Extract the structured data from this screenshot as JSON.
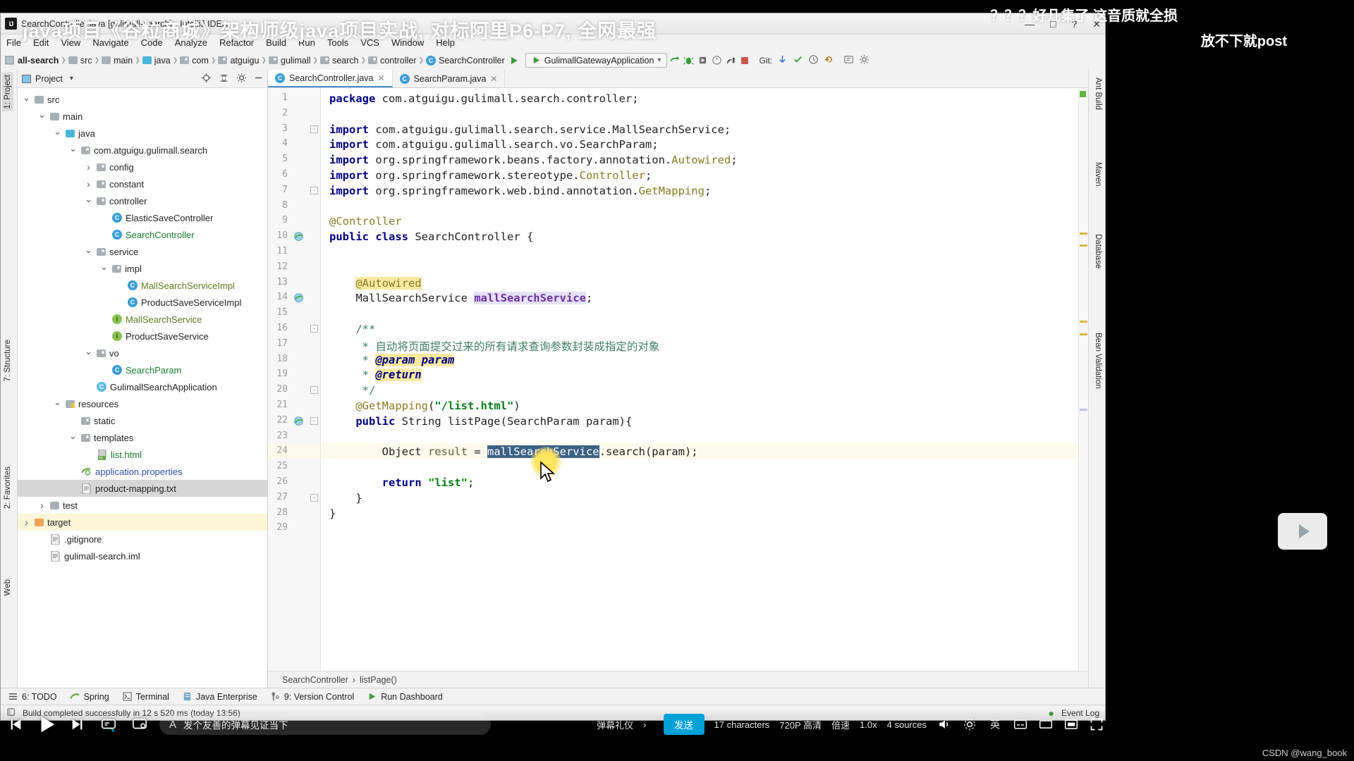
{
  "window": {
    "title": "SearchController.java [gulimall-search] - IntelliJ IDEA",
    "logo": "IJ",
    "minimize": "—",
    "maximize": "□",
    "help": "?",
    "close": "✕"
  },
  "menubar": [
    "File",
    "Edit",
    "View",
    "Navigate",
    "Code",
    "Analyze",
    "Refactor",
    "Build",
    "Run",
    "Tools",
    "VCS",
    "Window",
    "Help"
  ],
  "navbar": {
    "crumbs": [
      {
        "label": "all-search",
        "icon": "module-icon",
        "bold": true
      },
      {
        "label": "src",
        "icon": "folder-gray-icon"
      },
      {
        "label": "main",
        "icon": "folder-gray-icon"
      },
      {
        "label": "java",
        "icon": "folder-source-icon"
      },
      {
        "label": "com",
        "icon": "package-icon"
      },
      {
        "label": "atguigu",
        "icon": "package-icon"
      },
      {
        "label": "gulimall",
        "icon": "package-icon"
      },
      {
        "label": "search",
        "icon": "package-icon"
      },
      {
        "label": "controller",
        "icon": "package-icon"
      },
      {
        "label": "SearchController",
        "icon": "class-icon"
      }
    ],
    "run_config": "GulimallGatewayApplication",
    "run_config_dropdown": "▾",
    "git_label": "Git:"
  },
  "project_panel": {
    "title": "Project",
    "dropdown": "▾",
    "tree": [
      {
        "label": "src",
        "indent": 0,
        "twist": "v",
        "icon": "folder-gray-icon",
        "color": ""
      },
      {
        "label": "main",
        "indent": 1,
        "twist": "v",
        "icon": "folder-gray-icon",
        "color": ""
      },
      {
        "label": "java",
        "indent": 2,
        "twist": "v",
        "icon": "folder-source-icon",
        "color": ""
      },
      {
        "label": "com.atguigu.gulimall.search",
        "indent": 3,
        "twist": "v",
        "icon": "package-icon",
        "color": ""
      },
      {
        "label": "config",
        "indent": 4,
        "twist": ">",
        "icon": "package-icon",
        "color": ""
      },
      {
        "label": "constant",
        "indent": 4,
        "twist": ">",
        "icon": "package-icon",
        "color": ""
      },
      {
        "label": "controller",
        "indent": 4,
        "twist": "v",
        "icon": "package-icon",
        "color": ""
      },
      {
        "label": "ElasticSaveController",
        "indent": 5,
        "twist": "",
        "icon": "class-icon",
        "color": ""
      },
      {
        "label": "SearchController",
        "indent": 5,
        "twist": "",
        "icon": "class-icon",
        "color": "green"
      },
      {
        "label": "service",
        "indent": 4,
        "twist": "v",
        "icon": "package-icon",
        "color": ""
      },
      {
        "label": "impl",
        "indent": 5,
        "twist": "v",
        "icon": "package-icon",
        "color": ""
      },
      {
        "label": "MallSearchServiceImpl",
        "indent": 6,
        "twist": "",
        "icon": "class-icon",
        "color": "olive"
      },
      {
        "label": "ProductSaveServiceImpl",
        "indent": 6,
        "twist": "",
        "icon": "class-icon",
        "color": ""
      },
      {
        "label": "MallSearchService",
        "indent": 5,
        "twist": "",
        "icon": "interface-icon",
        "color": "olive"
      },
      {
        "label": "ProductSaveService",
        "indent": 5,
        "twist": "",
        "icon": "interface-icon",
        "color": ""
      },
      {
        "label": "vo",
        "indent": 4,
        "twist": "v",
        "icon": "package-icon",
        "color": ""
      },
      {
        "label": "SearchParam",
        "indent": 5,
        "twist": "",
        "icon": "class-icon",
        "color": "green"
      },
      {
        "label": "GulimallSearchApplication",
        "indent": 4,
        "twist": "",
        "icon": "spring-class-icon",
        "color": ""
      },
      {
        "label": "resources",
        "indent": 2,
        "twist": "v",
        "icon": "folder-resources-icon",
        "color": ""
      },
      {
        "label": "static",
        "indent": 3,
        "twist": "",
        "icon": "package-icon",
        "color": ""
      },
      {
        "label": "templates",
        "indent": 3,
        "twist": "v",
        "icon": "package-icon",
        "color": ""
      },
      {
        "label": "list.html",
        "indent": 4,
        "twist": "",
        "icon": "html-file-icon",
        "color": "green"
      },
      {
        "label": "application.properties",
        "indent": 3,
        "twist": "",
        "icon": "spring-properties-icon",
        "color": "blue"
      },
      {
        "label": "product-mapping.txt",
        "indent": 3,
        "twist": "",
        "icon": "text-file-icon",
        "color": "",
        "state": "selected"
      },
      {
        "label": "test",
        "indent": 1,
        "twist": ">",
        "icon": "folder-gray-icon",
        "color": ""
      },
      {
        "label": "target",
        "indent": 0,
        "twist": ">",
        "icon": "folder-orange-icon",
        "color": "",
        "state": "warn"
      },
      {
        "label": ".gitignore",
        "indent": 1,
        "twist": "",
        "icon": "text-file-icon",
        "color": ""
      },
      {
        "label": "gulimall-search.iml",
        "indent": 1,
        "twist": "",
        "icon": "text-file-icon",
        "color": ""
      }
    ]
  },
  "left_tool_tabs": [
    "1: Project",
    "7: Structure",
    "2: Favorites",
    "Web"
  ],
  "right_tool_tabs": [
    "Ant Build",
    "Maven",
    "Database",
    "Bean Validation"
  ],
  "editor": {
    "tabs": [
      {
        "label": "SearchController.java",
        "icon": "class-icon",
        "active": true,
        "close": "✕"
      },
      {
        "label": "SearchParam.java",
        "icon": "class-icon",
        "active": false,
        "close": "✕"
      }
    ],
    "breadcrumb": [
      "SearchController",
      "listPage()"
    ],
    "breadcrumb_sep": "›",
    "lines": [
      {
        "n": 1,
        "html": "<span class='kw'>package</span> com.atguigu.gulimall.search.controller;"
      },
      {
        "n": 2,
        "html": ""
      },
      {
        "n": 3,
        "html": "<span class='kw'>import</span> com.atguigu.gulimall.search.service.MallSearchService;",
        "fold": "-"
      },
      {
        "n": 4,
        "html": "<span class='kw'>import</span> com.atguigu.gulimall.search.vo.SearchParam;"
      },
      {
        "n": 5,
        "html": "<span class='kw'>import</span> org.springframework.beans.factory.annotation.<span class='ann'>Autowired</span>;"
      },
      {
        "n": 6,
        "html": "<span class='kw'>import</span> org.springframework.stereotype.<span class='ann'>Controller</span>;"
      },
      {
        "n": 7,
        "html": "<span class='kw'>import</span> org.springframework.web.bind.annotation.<span class='ann'>GetMapping</span>;",
        "fold": "-"
      },
      {
        "n": 8,
        "html": ""
      },
      {
        "n": 9,
        "html": "<span class='ann'>@Controller</span>"
      },
      {
        "n": 10,
        "html": "<span class='kw'>public</span> <span class='kw'>class</span> SearchController {",
        "gmark": "spring-bean-icon"
      },
      {
        "n": 11,
        "html": ""
      },
      {
        "n": 12,
        "html": ""
      },
      {
        "n": 13,
        "html": "    <span class='ann hly'>@Autowired</span>"
      },
      {
        "n": 14,
        "html": "    MallSearchService <span class='fld hlv'>mallSearchService</span>;",
        "gmark": "bean-injection-icon"
      },
      {
        "n": 15,
        "html": ""
      },
      {
        "n": 16,
        "html": "    <span class='cmt'>/**</span>",
        "fold": "-"
      },
      {
        "n": 17,
        "html": "     <span class='cmt'>* 自动将页面提交过来的所有请求查询参数封装成指定的对象</span>"
      },
      {
        "n": 18,
        "html": "     <span class='cmt'>* </span><span class='cmtb hly'>@param param</span>"
      },
      {
        "n": 19,
        "html": "     <span class='cmt'>* </span><span class='cmtb hly'>@return</span>"
      },
      {
        "n": 20,
        "html": "     <span class='cmt'>*/</span>",
        "fold": "-"
      },
      {
        "n": 21,
        "html": "    <span class='ann'>@GetMapping</span>(<span class='str'>\"/list.html\"</span>)"
      },
      {
        "n": 22,
        "html": "    <span class='kw'>public</span> String listPage(SearchParam param){",
        "gmark": "web-mapping-icon",
        "fold": "-"
      },
      {
        "n": 23,
        "html": ""
      },
      {
        "n": 24,
        "html": "        Object <span style='color:#6b5b3a'>result</span> = <span class='selbox'>mallSearchService</span>.search(param);",
        "highlight": true
      },
      {
        "n": 25,
        "html": ""
      },
      {
        "n": 26,
        "html": "        <span class='kw'>return</span> <span class='str'>\"list\"</span>;"
      },
      {
        "n": 27,
        "html": "    }",
        "fold": "-"
      },
      {
        "n": 28,
        "html": "}"
      },
      {
        "n": 29,
        "html": ""
      }
    ]
  },
  "bottom_tabs": [
    {
      "label": "6: TODO",
      "icon": "todo-icon"
    },
    {
      "label": "Spring",
      "icon": "spring-icon"
    },
    {
      "label": "Terminal",
      "icon": "terminal-icon"
    },
    {
      "label": "Java Enterprise",
      "icon": "java-ee-icon"
    },
    {
      "label": "9: Version Control",
      "icon": "version-control-icon"
    },
    {
      "label": "Run Dashboard",
      "icon": "run-dashboard-icon"
    }
  ],
  "statusbar": {
    "message": "Build completed successfully in 12 s 520 ms (today 13:56)",
    "event_log": "Event Log"
  },
  "player": {
    "play_icon": "play-icon",
    "prev_icon": "previous-icon",
    "next_icon": "next-icon",
    "danmaku_placeholder": "发个友善的弹幕见证当下",
    "danmaku_prefix_icon": "A",
    "send_label": "发送",
    "etiquette_label": "弹幕礼仪",
    "etiquette_arrow": "›",
    "char_count": "17 characters",
    "quality": "720P 高清",
    "speed": "倍速",
    "ratio": "1.0x",
    "voices": "4 sources",
    "volume_icon": "volume-icon",
    "settings_icon": "settings-icon",
    "subtitle_icon": "subtitle-icon",
    "widescreen_icon": "widescreen-icon",
    "webfull_icon": "web-fullscreen-icon",
    "fullscreen_icon": "fullscreen-icon",
    "lang_badge": "英"
  },
  "overlays": {
    "course_title": "java项目《谷粒商城》架构师级java项目实战, 对标阿里P6-P7, 全网最强",
    "danmaku_top": "？？？好几集了 这音质就全损",
    "danmaku_sub": "放不下就post",
    "watermark": "CSDN @wang_book"
  }
}
